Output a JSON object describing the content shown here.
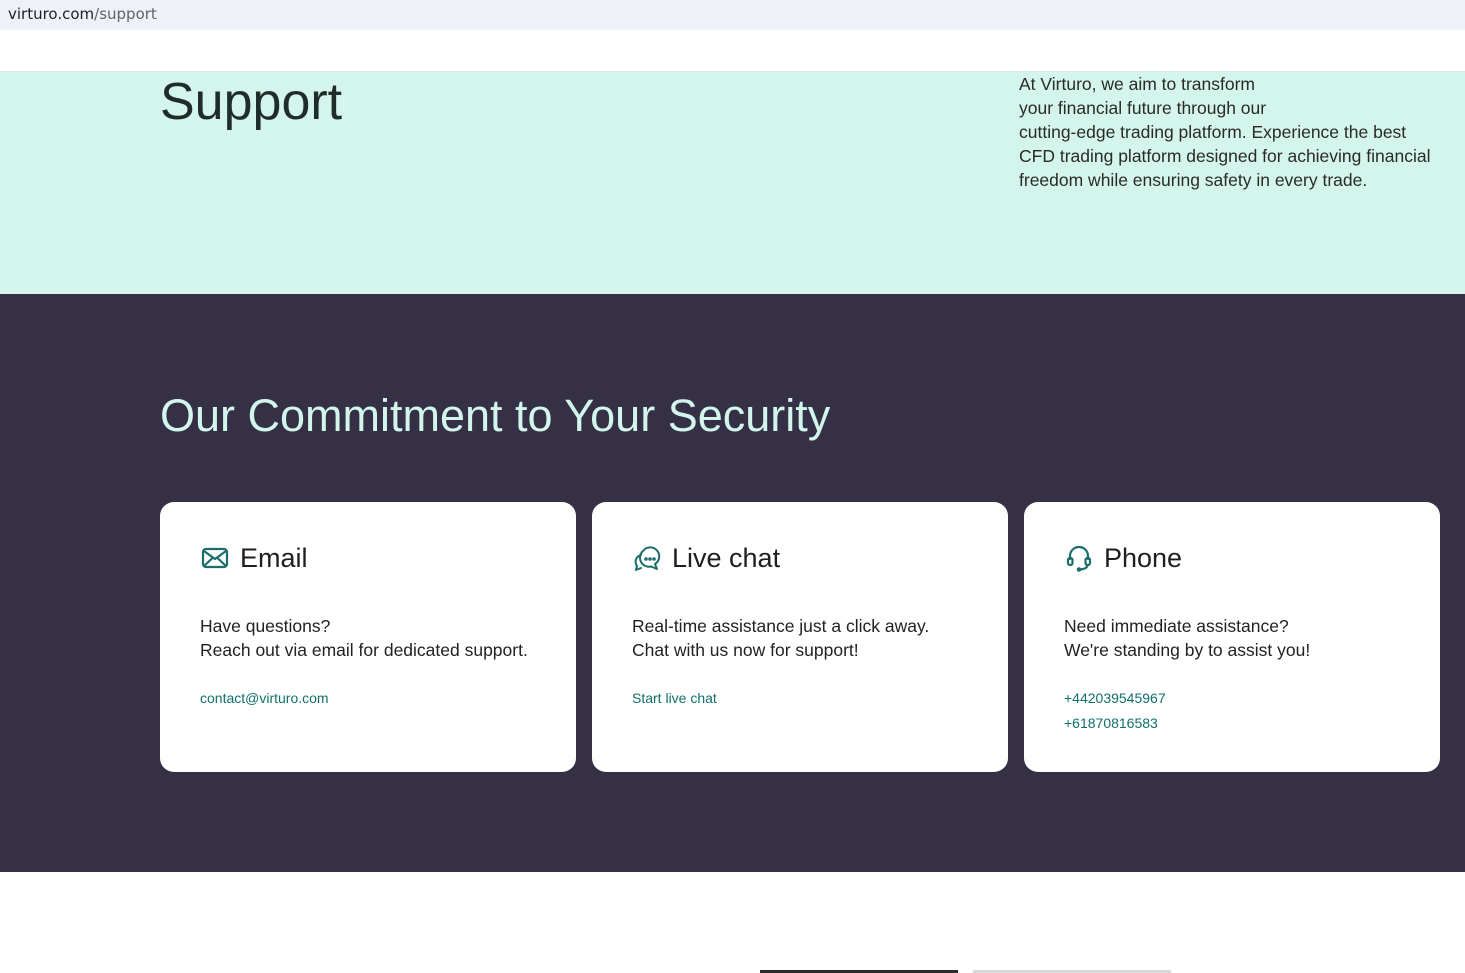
{
  "browser": {
    "url_host": "virturo.com",
    "url_path": "/support"
  },
  "hero": {
    "title": "Support",
    "intro_lines": [
      "At Virturo, we aim to transform",
      "your financial future through our",
      "cutting-edge trading platform. Experience the best",
      "CFD trading platform designed for achieving financial",
      "freedom while ensuring safety in every trade."
    ]
  },
  "security": {
    "heading": "Our Commitment to Your Security",
    "cards": [
      {
        "icon": "envelope-icon",
        "title": "Email",
        "desc_lines": [
          "Have questions?",
          "Reach out via email for dedicated support."
        ],
        "links": [
          "contact@virturo.com"
        ]
      },
      {
        "icon": "chat-bubbles-icon",
        "title": "Live chat",
        "desc_lines": [
          "Real-time assistance just a click away.",
          "Chat with us now for support!"
        ],
        "links": [
          "Start live chat"
        ]
      },
      {
        "icon": "headset-icon",
        "title": "Phone",
        "desc_lines": [
          "Need immediate assistance?",
          "We're standing by to assist you!"
        ],
        "links": [
          "+442039545967",
          "+61870816583"
        ]
      }
    ]
  },
  "colors": {
    "hero_bg": "#d4f5eb",
    "dark_bg": "#353045",
    "heading_mint": "#d2f6ec",
    "link_teal": "#11706a",
    "icon_teal": "#1b6e6a"
  }
}
